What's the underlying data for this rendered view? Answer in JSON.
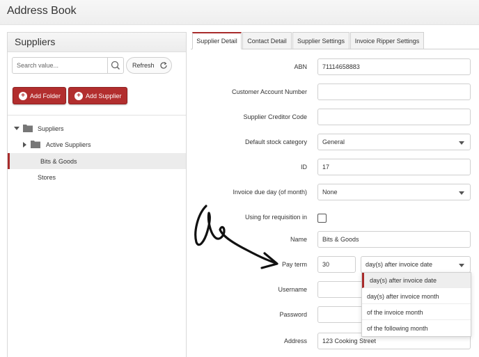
{
  "app": {
    "title": "Address Book"
  },
  "sidebar": {
    "title": "Suppliers",
    "search": {
      "placeholder": "Search value...",
      "value": ""
    },
    "refresh_label": "Refresh",
    "add_folder_label": "Add Folder",
    "add_supplier_label": "Add Supplier",
    "tree": {
      "root_label": "Suppliers",
      "active_label": "Active Suppliers",
      "selected_label": "Bits & Goods",
      "stores_label": "Stores"
    }
  },
  "tabs": [
    {
      "label": "Supplier Detail",
      "active": true
    },
    {
      "label": "Contact Detail",
      "active": false
    },
    {
      "label": "Supplier Settings",
      "active": false
    },
    {
      "label": "Invoice Ripper Settings",
      "active": false
    }
  ],
  "form": {
    "abn": {
      "label": "ABN",
      "value": "71114658883"
    },
    "customer_account": {
      "label": "Customer Account Number",
      "value": ""
    },
    "creditor_code": {
      "label": "Supplier Creditor Code",
      "value": ""
    },
    "stock_category": {
      "label": "Default stock category",
      "value": "General"
    },
    "id": {
      "label": "ID",
      "value": "17"
    },
    "invoice_due_day": {
      "label": "Invoice due day (of month)",
      "value": "None"
    },
    "requisition": {
      "label": "Using for requisition in",
      "checked": false
    },
    "name": {
      "label": "Name",
      "value": "Bits & Goods"
    },
    "pay_term": {
      "label": "Pay term",
      "value": "30",
      "unit": "day(s) after invoice date"
    },
    "username": {
      "label": "Username",
      "value": ""
    },
    "password": {
      "label": "Password",
      "value": ""
    },
    "address": {
      "label": "Address",
      "value": "123 Cooking Street"
    }
  },
  "pay_term_options": [
    "day(s) after invoice date",
    "day(s) after invoice month",
    "of the invoice month",
    "of the following month"
  ],
  "colors": {
    "accent": "#a82b2b",
    "button_red": "#b22e2e"
  }
}
